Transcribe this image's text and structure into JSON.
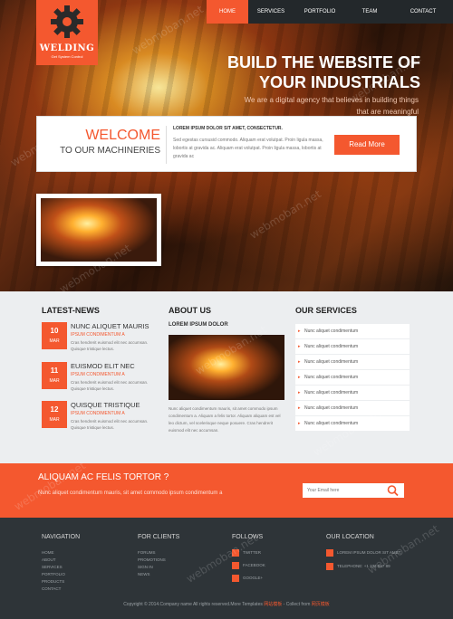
{
  "logo": {
    "brand": "WELDING",
    "tagline": "Get System Control"
  },
  "nav": {
    "items": [
      "HOME",
      "SERVICES",
      "PORTFOLIO",
      "TEAM",
      "CONTACT"
    ],
    "active": 0
  },
  "hero": {
    "title_line1": "BUILD THE WEBSITE OF",
    "title_line2": "YOUR INDUSTRIALS",
    "subtitle": "We are a digital agency that believes in building things that are meaningful"
  },
  "welcome": {
    "title": "WELCOME",
    "subtitle": "TO OUR MACHINERIES",
    "heading": "LOREM IPSUM DOLOR SIT AMET, CONSECTETUR.",
    "body": "Sed egestas cursusid commodo. Aliquam erat volutpat. Proin ligula massa, lobortis at gravida ac. Aliquam erat volutpat. Proin ligula massa, lobortis at gravida ac",
    "button": "Read More"
  },
  "columns": {
    "news_title": "LATEST-NEWS",
    "about_title": "ABOUT US",
    "services_title": "OUR SERVICES"
  },
  "news": [
    {
      "day": "10",
      "month": "MAR",
      "title": "NUNC ALIQUET MAURIS",
      "sub": "IPSUM CONDIMENTUM A",
      "text": "Cras hendrerit euismod elit nec accumsan. Quisque tristique lectus."
    },
    {
      "day": "11",
      "month": "MAR",
      "title": "EUISMOD ELIT NEC",
      "sub": "IPSUM CONDIMENTUM A",
      "text": "Cras hendrerit euismod elit nec accumsan. Quisque tristique lectus."
    },
    {
      "day": "12",
      "month": "MAR",
      "title": "QUISQUE TRISTIQUE",
      "sub": "IPSUM CONDIMENTUM A",
      "text": "Cras hendrerit euismod elit nec accumsan. Quisque tristique lectus."
    }
  ],
  "about": {
    "subtitle": "LOREM IPSUM DOLOR",
    "text": "Nunc aliquet condimentum mauris, sit amet commodo ipsum condimentum a. Aliquam a felis tortor. Aliquam aliquam est vel leo dictum, vel scelerisque neque posuere. Cras hendrerit euismod elit nec accumsan."
  },
  "services": [
    "Nunc aliquet condimentum",
    "Nunc aliquet condimentum",
    "Nunc aliquet condimentum",
    "Nunc aliquet condimentum",
    "Nunc aliquet condimentum",
    "Nunc aliquet condimentum",
    "Nunc aliquet condimentum"
  ],
  "cta": {
    "title": "ALIQUAM AC FELIS TORTOR ?",
    "text": "Nunc aliquet condimentum mauris, sit amet commodo ipsum condimentum a",
    "email_placeholder": "Your Email here"
  },
  "footer": {
    "navigation_title": "NAVIGATION",
    "navigation": [
      "HOME",
      "ABOUT",
      "SERVICES",
      "PORTFOLIO",
      "PRODUCTS",
      "CONTACT"
    ],
    "clients_title": "FOR CLIENTS",
    "clients": [
      "FORUMS",
      "PROMOTIONS",
      "SIGN IN",
      "NEWS"
    ],
    "follows_title": "FOLLOWS",
    "follows": [
      "TWITTER",
      "FACEBOOK",
      "GOOGLE+"
    ],
    "location_title": "OUR LOCATION",
    "location": [
      "LOREM IPSUM DOLOR SIT AMET,",
      "TELEPHONE: +1 234 567 89"
    ],
    "copyright": "Copyright © 2014.Company name All rights reserved.More Templates",
    "copyright_hl1": "网站模板",
    "copyright_mid": " - Collect from ",
    "copyright_hl2": "网页模板"
  },
  "watermark": "webmoban.net",
  "colors": {
    "accent": "#f4582f",
    "dark": "#2e3438",
    "nav": "#23282b"
  }
}
